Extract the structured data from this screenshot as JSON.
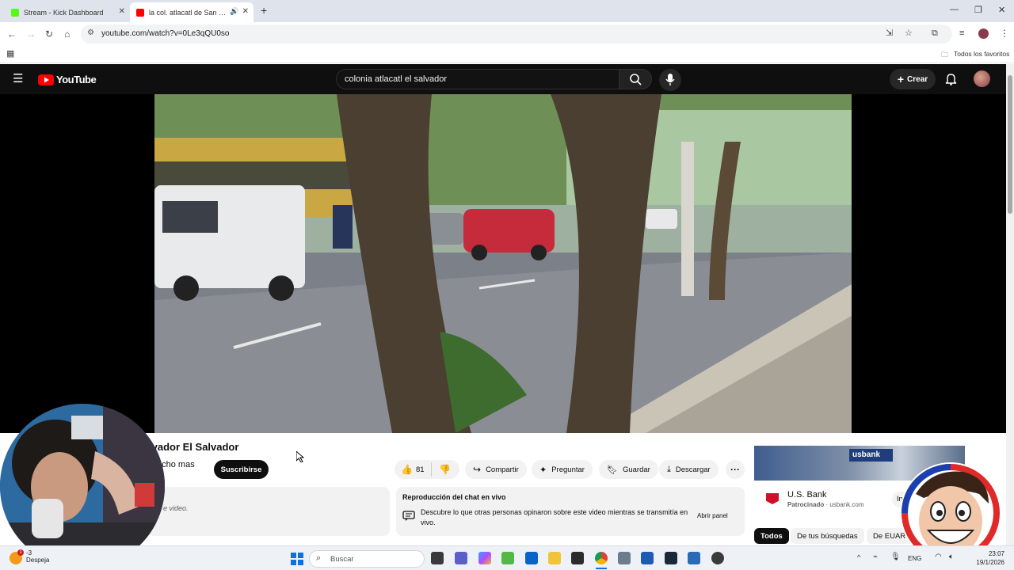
{
  "browser": {
    "tabs": [
      {
        "title": "Stream - Kick Dashboard",
        "active": false,
        "favicon_color": "#53fc18"
      },
      {
        "title": "la col. atlacatl de San Salva",
        "active": true,
        "favicon_color": "#ff0000"
      }
    ],
    "url": "youtube.com/watch?v=0Le3qQU0so",
    "bookmarks_label": "Todos los favoritos"
  },
  "youtube": {
    "logo_text": "YouTube",
    "search_query": "colonia atlacatl el salvador",
    "create_label": "Crear"
  },
  "video": {
    "title_visible": "lvador El Salvador",
    "channel_partial": "ucho mas",
    "subscribe_label": "Suscribirse",
    "likes": "81",
    "share_label": "Compartir",
    "ask_label": "Preguntar",
    "save_label": "Guardar",
    "download_label": "Descargar",
    "description_partial": "e video."
  },
  "live_chat": {
    "title": "Reproducción del chat en vivo",
    "description": "Descubre lo que otras personas opinaron sobre este video mientras se transmitía en vivo.",
    "button": "Abrir panel"
  },
  "ad": {
    "image_text": "usbank",
    "title": "U.S. Bank",
    "sponsored": "Patrocinado",
    "domain": "usbank.com",
    "cta_partial": "In"
  },
  "chips": [
    "Todos",
    "De tus búsquedas",
    "De EUART"
  ],
  "taskbar": {
    "search_placeholder": "Buscar",
    "weather_temp": "-3",
    "weather_text": "Despeja",
    "language": "ENG",
    "time": "23:07",
    "date": "19/1/2026"
  },
  "colors": {
    "youtube_red": "#ff0000",
    "dark_bg": "#0f0f0f",
    "accent_blue": "#065fd4"
  }
}
